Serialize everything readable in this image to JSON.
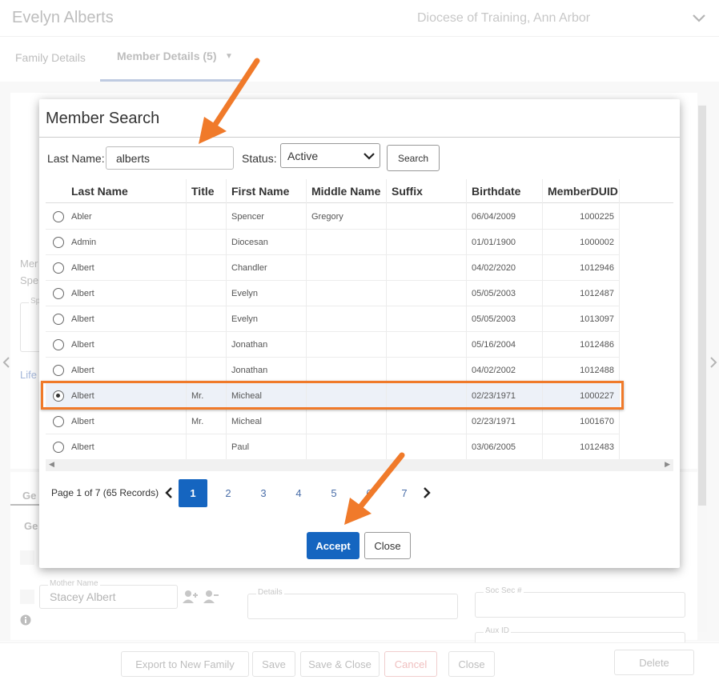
{
  "header": {
    "member_name": "Evelyn Alberts",
    "organization": "Diocese of Training, Ann Arbor"
  },
  "tabs": [
    {
      "label": "Family Details"
    },
    {
      "label": "Member Details (5)"
    }
  ],
  "background": {
    "partial_labels": [
      "Mer",
      "Spe",
      "Sp",
      "Life",
      "Ge",
      "Ge"
    ],
    "mother_name_label": "Mother Name",
    "mother_name_value": "Stacey Albert",
    "details_label": "Details",
    "soc_sec_label": "Soc Sec #",
    "aux_id_label": "Aux ID"
  },
  "footer": {
    "export_label": "Export to New Family",
    "save_label": "Save",
    "save_close_label": "Save & Close",
    "cancel_label": "Cancel",
    "close_label": "Close",
    "delete_label": "Delete"
  },
  "modal": {
    "title": "Member Search",
    "last_name_label": "Last Name:",
    "last_name_value": "alberts",
    "status_label": "Status:",
    "status_value": "Active",
    "search_label": "Search",
    "columns": [
      "Last Name",
      "Title",
      "First Name",
      "Middle Name",
      "Suffix",
      "Birthdate",
      "MemberDUID"
    ],
    "rows": [
      {
        "last": "Abler",
        "title": "",
        "first": "Spencer",
        "middle": "Gregory",
        "suffix": "",
        "birth": "06/04/2009",
        "duid": "1000225",
        "selected": false
      },
      {
        "last": "Admin",
        "title": "",
        "first": "Diocesan",
        "middle": "",
        "suffix": "",
        "birth": "01/01/1900",
        "duid": "1000002",
        "selected": false
      },
      {
        "last": "Albert",
        "title": "",
        "first": "Chandler",
        "middle": "",
        "suffix": "",
        "birth": "04/02/2020",
        "duid": "1012946",
        "selected": false
      },
      {
        "last": "Albert",
        "title": "",
        "first": "Evelyn",
        "middle": "",
        "suffix": "",
        "birth": "05/05/2003",
        "duid": "1012487",
        "selected": false
      },
      {
        "last": "Albert",
        "title": "",
        "first": "Evelyn",
        "middle": "",
        "suffix": "",
        "birth": "05/05/2003",
        "duid": "1013097",
        "selected": false
      },
      {
        "last": "Albert",
        "title": "",
        "first": "Jonathan",
        "middle": "",
        "suffix": "",
        "birth": "05/16/2004",
        "duid": "1012486",
        "selected": false
      },
      {
        "last": "Albert",
        "title": "",
        "first": "Jonathan",
        "middle": "",
        "suffix": "",
        "birth": "04/02/2002",
        "duid": "1012488",
        "selected": false
      },
      {
        "last": "Albert",
        "title": "Mr.",
        "first": "Micheal",
        "middle": "",
        "suffix": "",
        "birth": "02/23/1971",
        "duid": "1000227",
        "selected": true
      },
      {
        "last": "Albert",
        "title": "Mr.",
        "first": "Micheal",
        "middle": "",
        "suffix": "",
        "birth": "02/23/1971",
        "duid": "1001670",
        "selected": false
      },
      {
        "last": "Albert",
        "title": "",
        "first": "Paul",
        "middle": "",
        "suffix": "",
        "birth": "03/06/2005",
        "duid": "1012483",
        "selected": false
      }
    ],
    "pager_text": "Page 1 of 7 (65 Records)",
    "pages": [
      "1",
      "2",
      "3",
      "4",
      "5",
      "6",
      "7"
    ],
    "active_page": "1",
    "accept_label": "Accept",
    "close_label": "Close"
  },
  "colors": {
    "accent_blue": "#1565c0",
    "annotation_orange": "#f07a2a"
  }
}
